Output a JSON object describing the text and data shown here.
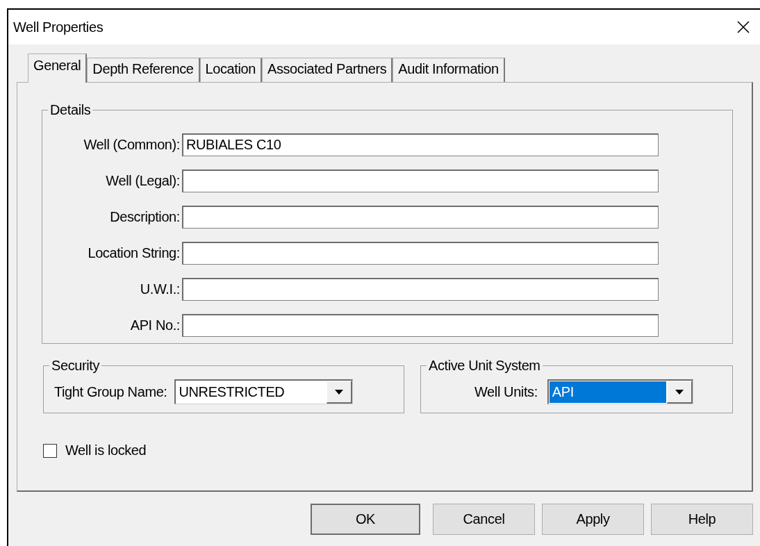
{
  "window": {
    "title": "Well Properties"
  },
  "tabs": [
    {
      "label": "General",
      "selected": true
    },
    {
      "label": "Depth Reference",
      "selected": false
    },
    {
      "label": "Location",
      "selected": false
    },
    {
      "label": "Associated Partners",
      "selected": false
    },
    {
      "label": "Audit Information",
      "selected": false
    }
  ],
  "details": {
    "title": "Details",
    "fields": [
      {
        "label": "Well (Common):",
        "value": "RUBIALES C10"
      },
      {
        "label": "Well (Legal):"
      },
      {
        "label": "Description:"
      },
      {
        "label": "Location String:"
      },
      {
        "label": "U.W.I.:"
      },
      {
        "label": "API No.:"
      }
    ]
  },
  "security": {
    "title": "Security",
    "label": "Tight Group Name:",
    "value": "UNRESTRICTED",
    "selected": false
  },
  "unit_system": {
    "title": "Active Unit System",
    "label": "Well Units:",
    "value": "API",
    "selected": true
  },
  "locked": {
    "label": "Well is locked",
    "checked": false
  },
  "buttons": [
    {
      "label": "OK",
      "default": true
    },
    {
      "label": "Cancel",
      "default": false
    },
    {
      "label": "Apply",
      "default": false
    },
    {
      "label": "Help",
      "default": false
    }
  ]
}
